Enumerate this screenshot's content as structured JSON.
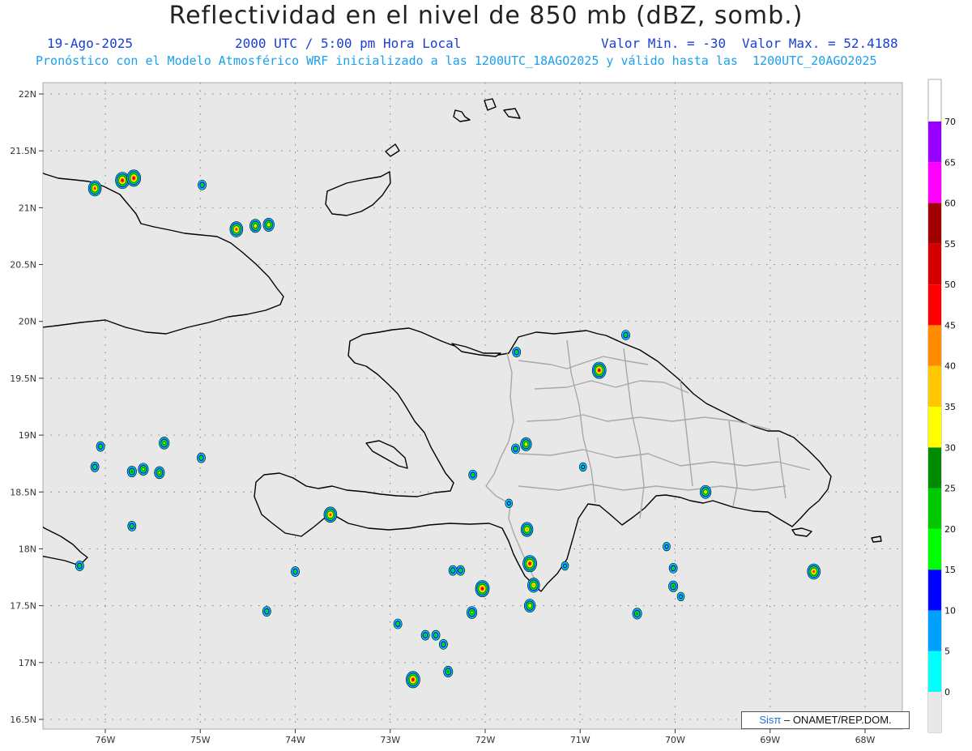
{
  "header": {
    "title": "Reflectividad en el nivel de 850 mb (dBZ, somb.)",
    "date": "19-Ago-2025",
    "time": "2000 UTC / 5:00 pm Hora Local",
    "min_label": "Valor Min. = -30",
    "max_label": "Valor Max. = 52.4188",
    "forecast_note": "Pronóstico con el Modelo Atmosférico WRF inicializado a las 1200UTC_18AGO2025 y válido hasta las  1200UTC_20AGO2025"
  },
  "colors": {
    "header_date": "#1a3fd4",
    "header_note": "#1aa0ee",
    "map_background": "#e8e8e8",
    "coast": "#000000",
    "provinces": "#a8a8a8"
  },
  "axes": {
    "lat_labels": [
      "22N",
      "21.5N",
      "21N",
      "20.5N",
      "20N",
      "19.5N",
      "19N",
      "18.5N",
      "18N",
      "17.5N",
      "17N",
      "16.5N"
    ],
    "lon_labels": [
      "76W",
      "75W",
      "74W",
      "73W",
      "72W",
      "71W",
      "70W",
      "69W",
      "68W"
    ]
  },
  "colorbar": {
    "labels": [
      "0",
      "5",
      "10",
      "15",
      "20",
      "25",
      "30",
      "35",
      "40",
      "45",
      "50",
      "55",
      "60",
      "65",
      "70"
    ],
    "colors": [
      "#00ffff",
      "#00a0ff",
      "#0000ff",
      "#00ff00",
      "#00c800",
      "#008c00",
      "#ffff00",
      "#ffc800",
      "#ff8c00",
      "#ff0000",
      "#d40000",
      "#a00000",
      "#ff00ff",
      "#9600ff"
    ]
  },
  "cells": [
    {
      "lon": -75.82,
      "lat": 21.24,
      "dbz": 50
    },
    {
      "lon": -75.7,
      "lat": 21.26,
      "dbz": 50
    },
    {
      "lon": -76.11,
      "lat": 21.17,
      "dbz": 45
    },
    {
      "lon": -74.98,
      "lat": 21.2,
      "dbz": 20
    },
    {
      "lon": -74.62,
      "lat": 20.81,
      "dbz": 45
    },
    {
      "lon": -74.42,
      "lat": 20.84,
      "dbz": 35
    },
    {
      "lon": -74.28,
      "lat": 20.85,
      "dbz": 35
    },
    {
      "lon": -70.8,
      "lat": 19.57,
      "dbz": 50
    },
    {
      "lon": -70.52,
      "lat": 19.88,
      "dbz": 20
    },
    {
      "lon": -71.67,
      "lat": 19.73,
      "dbz": 20
    },
    {
      "lon": -71.57,
      "lat": 18.92,
      "dbz": 35
    },
    {
      "lon": -71.56,
      "lat": 18.17,
      "dbz": 40
    },
    {
      "lon": -71.53,
      "lat": 17.87,
      "dbz": 50
    },
    {
      "lon": -71.49,
      "lat": 17.68,
      "dbz": 40
    },
    {
      "lon": -71.53,
      "lat": 17.5,
      "dbz": 35
    },
    {
      "lon": -72.03,
      "lat": 17.65,
      "dbz": 50
    },
    {
      "lon": -72.14,
      "lat": 17.44,
      "dbz": 30
    },
    {
      "lon": -72.76,
      "lat": 16.85,
      "dbz": 50
    },
    {
      "lon": -73.63,
      "lat": 18.3,
      "dbz": 45
    },
    {
      "lon": -69.68,
      "lat": 18.5,
      "dbz": 35
    },
    {
      "lon": -68.54,
      "lat": 17.8,
      "dbz": 45
    },
    {
      "lon": -70.4,
      "lat": 17.43,
      "dbz": 25
    },
    {
      "lon": -70.02,
      "lat": 17.67,
      "dbz": 25
    },
    {
      "lon": -72.44,
      "lat": 17.16,
      "dbz": 20
    },
    {
      "lon": -72.39,
      "lat": 16.92,
      "dbz": 25
    },
    {
      "lon": -72.52,
      "lat": 17.24,
      "dbz": 20
    },
    {
      "lon": -72.63,
      "lat": 17.24,
      "dbz": 20
    },
    {
      "lon": -72.92,
      "lat": 17.34,
      "dbz": 20
    },
    {
      "lon": -72.26,
      "lat": 17.81,
      "dbz": 20
    },
    {
      "lon": -72.34,
      "lat": 17.81,
      "dbz": 20
    },
    {
      "lon": -75.38,
      "lat": 18.93,
      "dbz": 30
    },
    {
      "lon": -75.6,
      "lat": 18.7,
      "dbz": 30
    },
    {
      "lon": -75.72,
      "lat": 18.68,
      "dbz": 25
    },
    {
      "lon": -75.43,
      "lat": 18.67,
      "dbz": 30
    },
    {
      "lon": -76.05,
      "lat": 18.9,
      "dbz": 20
    },
    {
      "lon": -76.11,
      "lat": 18.72,
      "dbz": 20
    },
    {
      "lon": -74.99,
      "lat": 18.8,
      "dbz": 20
    },
    {
      "lon": -75.72,
      "lat": 18.2,
      "dbz": 20
    },
    {
      "lon": -76.27,
      "lat": 17.85,
      "dbz": 20
    },
    {
      "lon": -74.0,
      "lat": 17.8,
      "dbz": 20
    },
    {
      "lon": -74.3,
      "lat": 17.45,
      "dbz": 20
    },
    {
      "lon": -70.02,
      "lat": 17.83,
      "dbz": 20
    },
    {
      "lon": -70.09,
      "lat": 18.02,
      "dbz": 15
    },
    {
      "lon": -69.94,
      "lat": 17.58,
      "dbz": 15
    },
    {
      "lon": -70.97,
      "lat": 18.72,
      "dbz": 15
    },
    {
      "lon": -71.16,
      "lat": 17.85,
      "dbz": 15
    },
    {
      "lon": -71.68,
      "lat": 18.88,
      "dbz": 20
    },
    {
      "lon": -72.13,
      "lat": 18.65,
      "dbz": 20
    },
    {
      "lon": -71.75,
      "lat": 18.4,
      "dbz": 15
    }
  ]
}
